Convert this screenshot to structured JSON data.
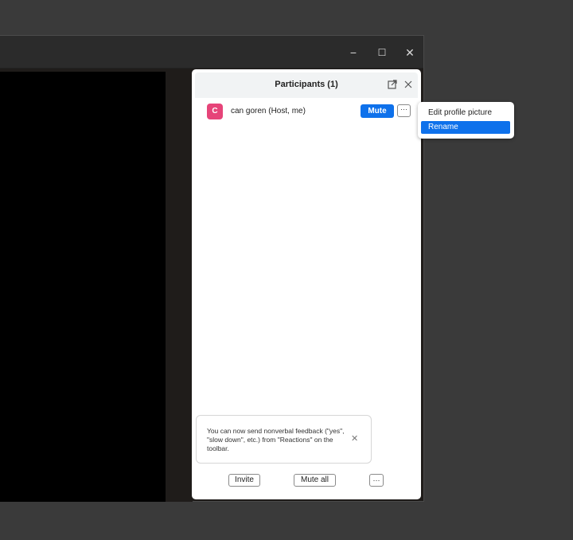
{
  "window": {
    "controls": {
      "minimize_icon": "−",
      "maximize_icon": "☐",
      "close_icon": "✕"
    }
  },
  "participants_panel": {
    "title": "Participants (1)",
    "participant": {
      "avatar_letter": "C",
      "avatar_color": "#e64479",
      "name": "can goren (Host, me)",
      "mute_label": "Mute",
      "more_label": "···"
    },
    "notice": {
      "text": "You can now send nonverbal feedback (\"yes\", \"slow down\", etc.) from \"Reactions\" on the toolbar.",
      "close_icon": "✕"
    },
    "footer": {
      "invite_label": "Invite",
      "mute_all_label": "Mute all",
      "more_label": "···"
    }
  },
  "context_menu": {
    "items": [
      {
        "label": "Edit profile picture",
        "selected": false
      },
      {
        "label": "Rename",
        "selected": true
      }
    ]
  },
  "colors": {
    "accent": "#0e71eb",
    "avatar": "#e64479"
  }
}
